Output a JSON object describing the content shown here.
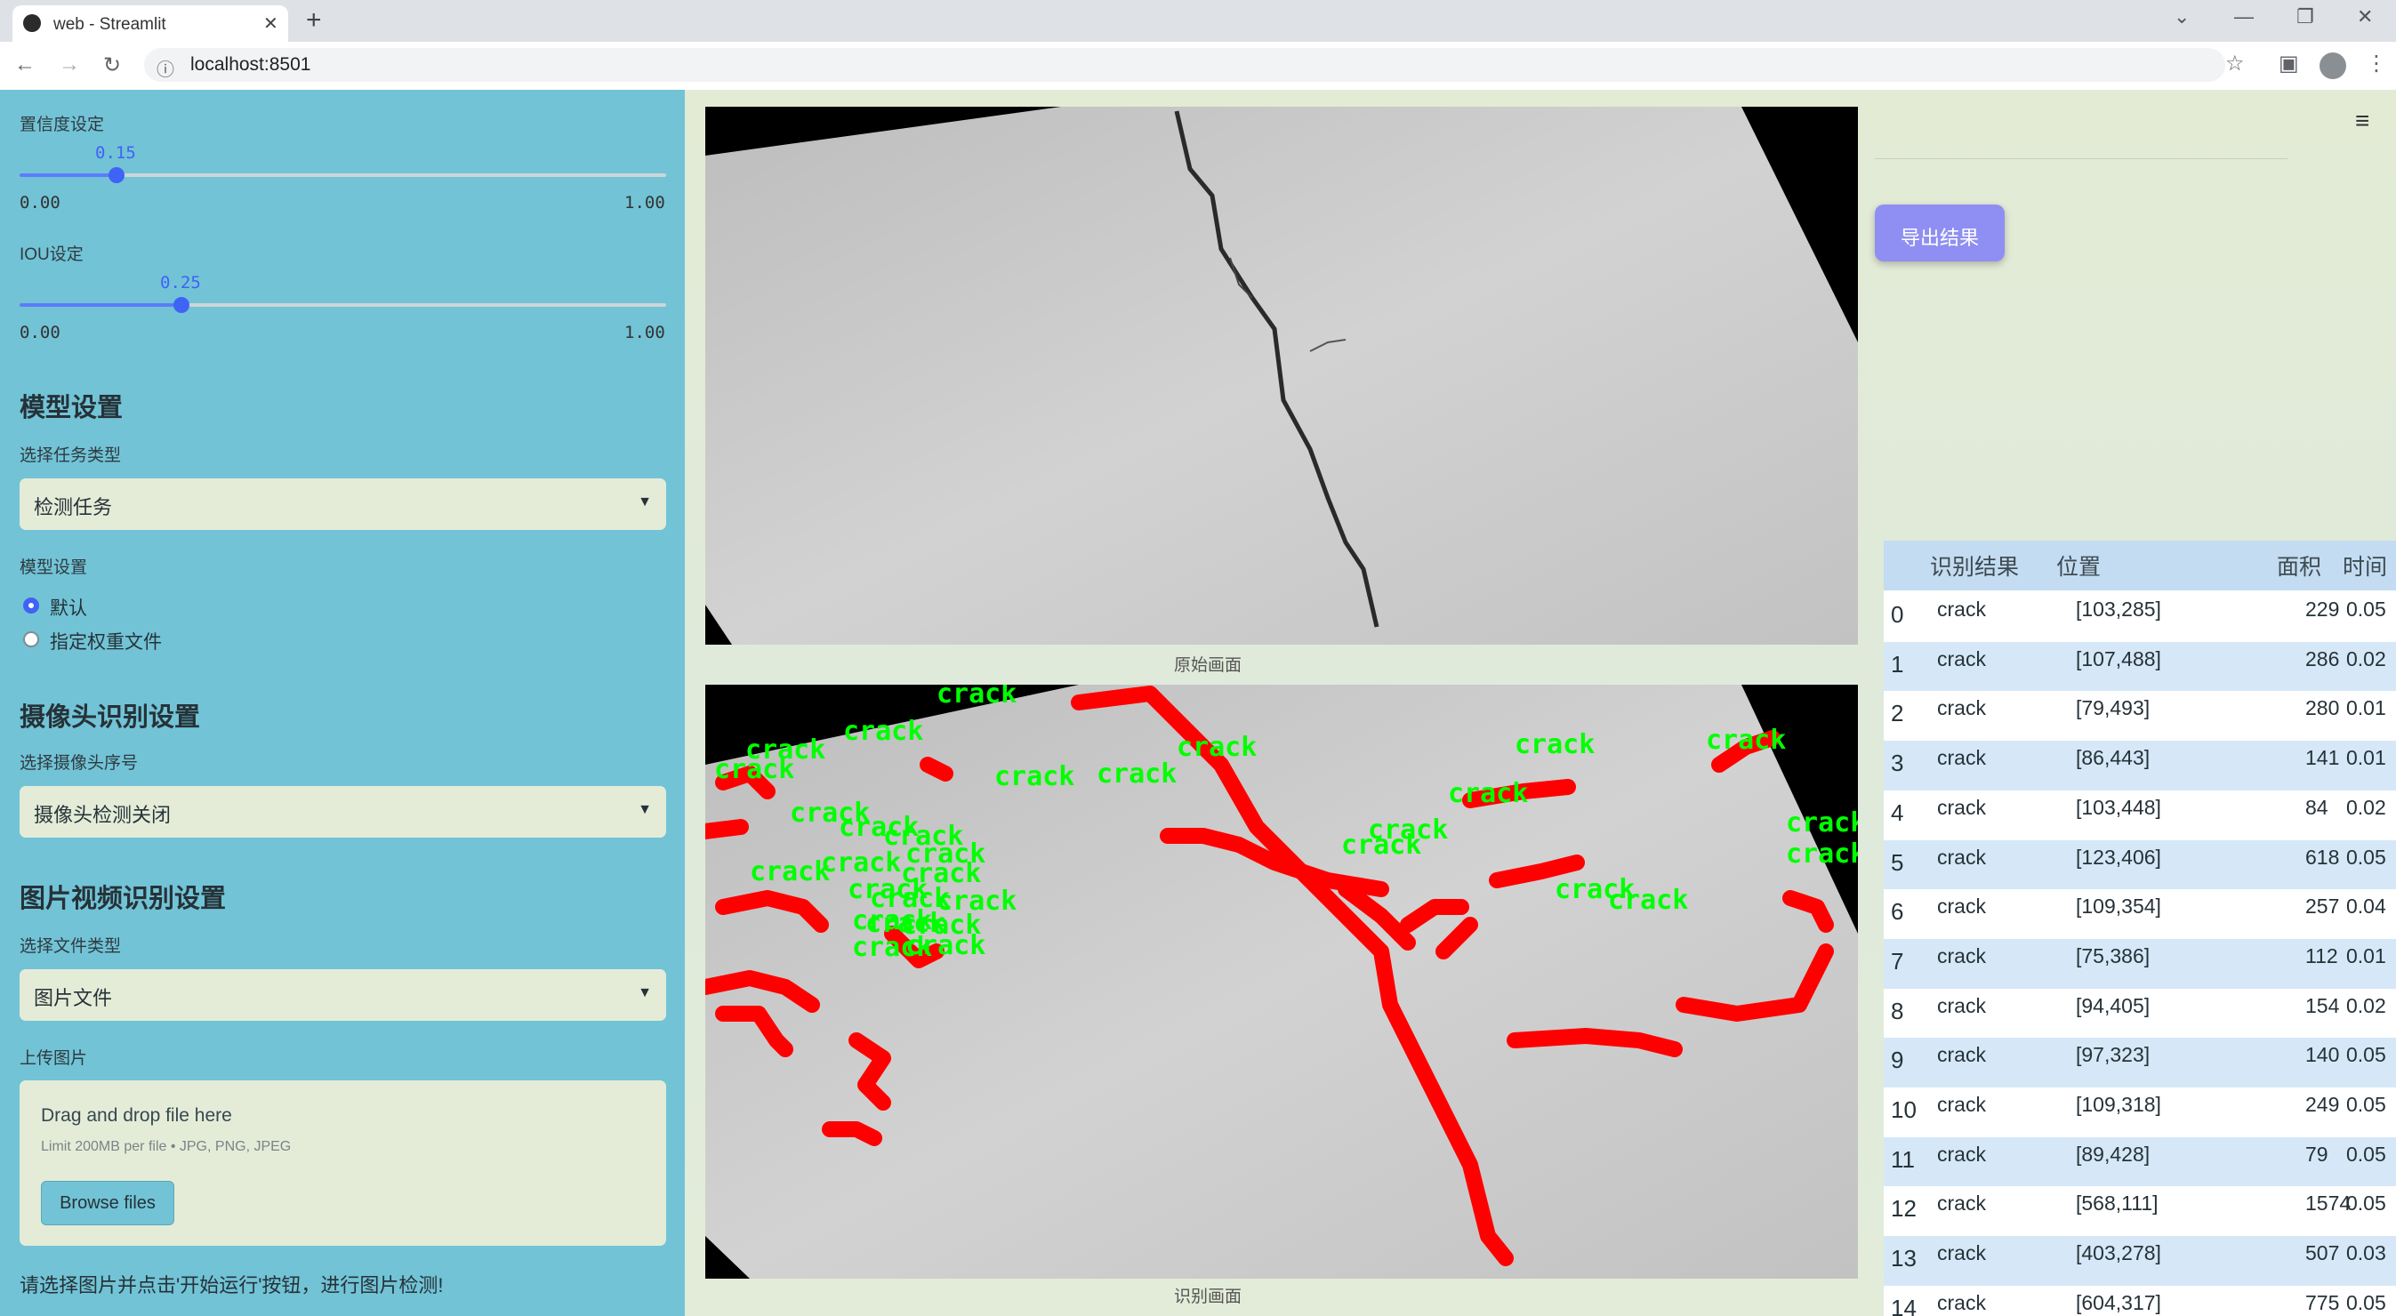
{
  "browser": {
    "tab_title": "web - Streamlit",
    "url": "localhost:8501"
  },
  "sidebar": {
    "confidence": {
      "label": "置信度设定",
      "value": 0.15,
      "value_text": "0.15",
      "min": "0.00",
      "max": "1.00"
    },
    "iou": {
      "label": "IOU设定",
      "value": 0.25,
      "value_text": "0.25",
      "min": "0.00",
      "max": "1.00"
    },
    "model_section": {
      "title": "模型设置",
      "task_label": "选择任务类型",
      "task_value": "检测任务",
      "model_label": "模型设置",
      "options": [
        "默认",
        "指定权重文件"
      ],
      "selected": 0
    },
    "camera_section": {
      "title": "摄像头识别设置",
      "camera_label": "选择摄像头序号",
      "camera_value": "摄像头检测关闭"
    },
    "media_section": {
      "title": "图片视频识别设置",
      "file_type_label": "选择文件类型",
      "file_type_value": "图片文件",
      "upload_label": "上传图片",
      "drop_text": "Drag and drop file here",
      "limit_text": "Limit 200MB per file • JPG, PNG, JPEG",
      "browse_label": "Browse files"
    },
    "hint": "请选择图片并点击'开始运行'按钮，进行图片检测!"
  },
  "main": {
    "original_caption": "原始画面",
    "result_caption": "识别画面",
    "export_label": "导出结果",
    "detection_label": "crack",
    "colors": {
      "accent": "#3f63f5",
      "sidebar": "#72c3d6",
      "mask": "#ff0000",
      "label_text": "#00ff00",
      "button": "#8f8ff3"
    }
  },
  "table": {
    "columns": [
      "识别结果",
      "位置",
      "面积",
      "时间"
    ],
    "rows": [
      {
        "idx": "0",
        "result": "crack",
        "pos": "[103,285]",
        "area": "229",
        "time": "0.05"
      },
      {
        "idx": "1",
        "result": "crack",
        "pos": "[107,488]",
        "area": "286",
        "time": "0.02"
      },
      {
        "idx": "2",
        "result": "crack",
        "pos": "[79,493]",
        "area": "280",
        "time": "0.01"
      },
      {
        "idx": "3",
        "result": "crack",
        "pos": "[86,443]",
        "area": "141",
        "time": "0.01"
      },
      {
        "idx": "4",
        "result": "crack",
        "pos": "[103,448]",
        "area": "84",
        "time": "0.02"
      },
      {
        "idx": "5",
        "result": "crack",
        "pos": "[123,406]",
        "area": "618",
        "time": "0.05"
      },
      {
        "idx": "6",
        "result": "crack",
        "pos": "[109,354]",
        "area": "257",
        "time": "0.04"
      },
      {
        "idx": "7",
        "result": "crack",
        "pos": "[75,386]",
        "area": "112",
        "time": "0.01"
      },
      {
        "idx": "8",
        "result": "crack",
        "pos": "[94,405]",
        "area": "154",
        "time": "0.02"
      },
      {
        "idx": "9",
        "result": "crack",
        "pos": "[97,323]",
        "area": "140",
        "time": "0.05"
      },
      {
        "idx": "10",
        "result": "crack",
        "pos": "[109,318]",
        "area": "249",
        "time": "0.05"
      },
      {
        "idx": "11",
        "result": "crack",
        "pos": "[89,428]",
        "area": "79",
        "time": "0.05"
      },
      {
        "idx": "12",
        "result": "crack",
        "pos": "[568,111]",
        "area": "1574",
        "time": "0.05"
      },
      {
        "idx": "13",
        "result": "crack",
        "pos": "[403,278]",
        "area": "507",
        "time": "0.03"
      },
      {
        "idx": "14",
        "result": "crack",
        "pos": "[604,317]",
        "area": "775",
        "time": "0.05"
      }
    ]
  }
}
